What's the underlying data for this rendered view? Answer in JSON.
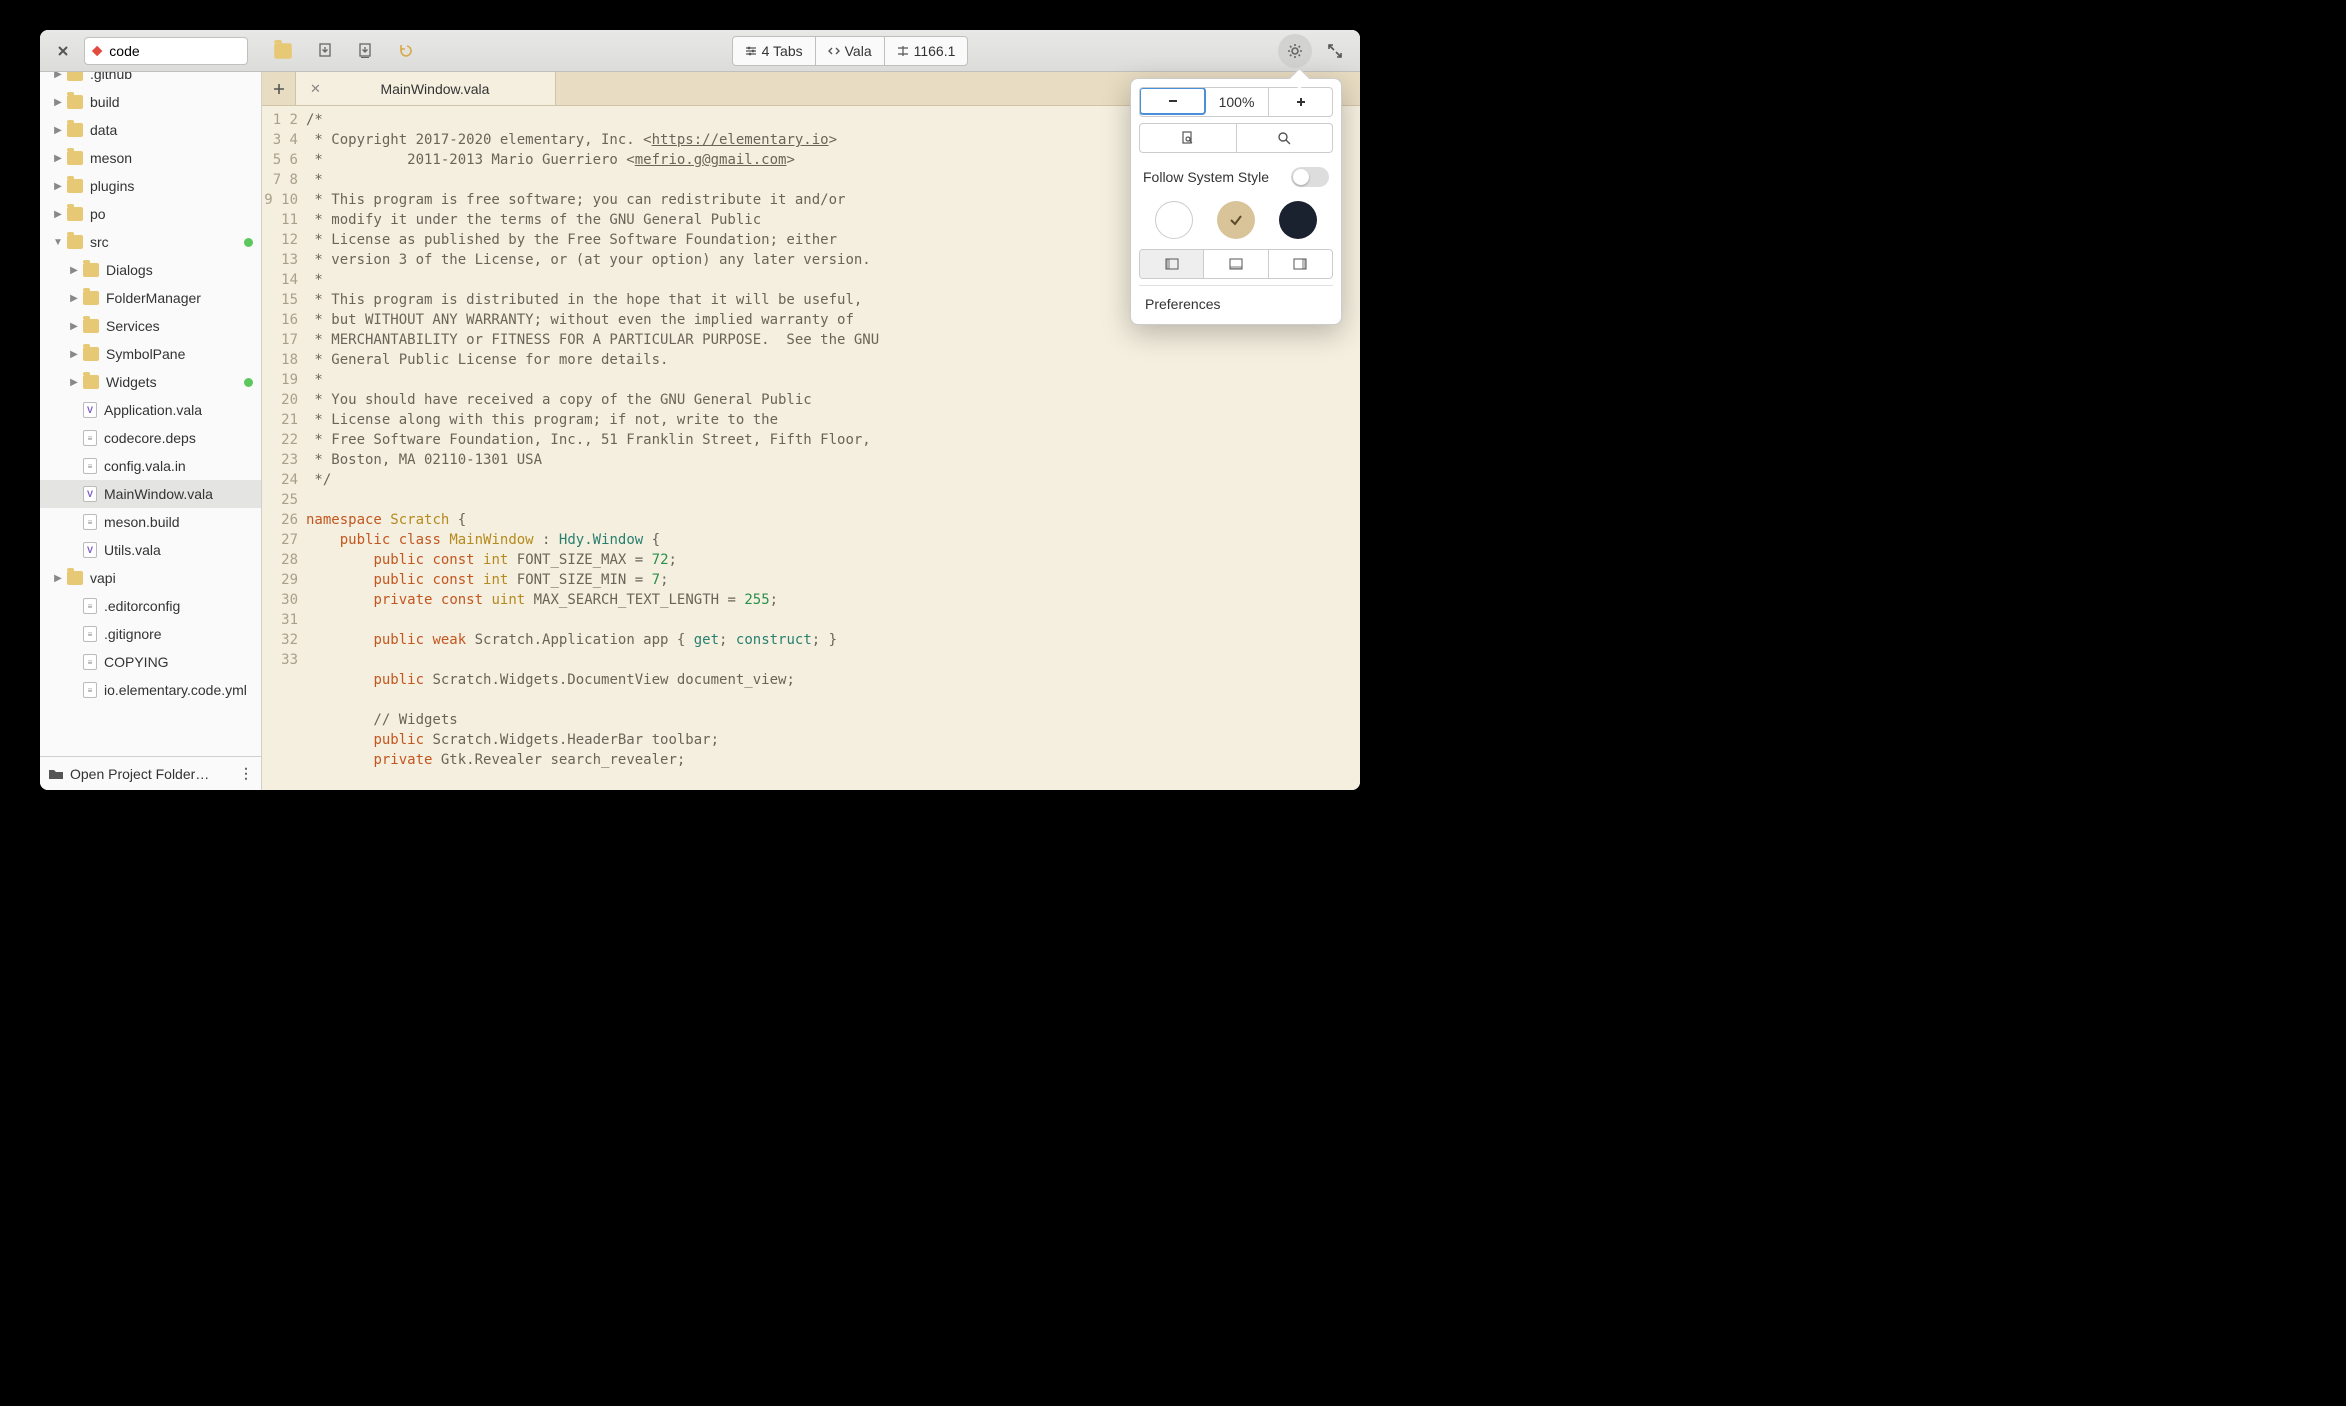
{
  "search": {
    "value": "code"
  },
  "toolbar": {
    "tabs_label": "4 Tabs",
    "lang_label": "Vala",
    "line_label": "1166.1"
  },
  "tree": [
    {
      "d": 0,
      "t": "folder",
      "exp": "right",
      "label": ".github",
      "cut": true
    },
    {
      "d": 0,
      "t": "folder",
      "exp": "right",
      "label": "build"
    },
    {
      "d": 0,
      "t": "folder",
      "exp": "right",
      "label": "data"
    },
    {
      "d": 0,
      "t": "folder",
      "exp": "right",
      "label": "meson"
    },
    {
      "d": 0,
      "t": "folder",
      "exp": "right",
      "label": "plugins"
    },
    {
      "d": 0,
      "t": "folder",
      "exp": "right",
      "label": "po"
    },
    {
      "d": 0,
      "t": "folder",
      "exp": "down",
      "label": "src",
      "dot": true
    },
    {
      "d": 1,
      "t": "folder",
      "exp": "right",
      "label": "Dialogs"
    },
    {
      "d": 1,
      "t": "folder",
      "exp": "right",
      "label": "FolderManager"
    },
    {
      "d": 1,
      "t": "folder",
      "exp": "right",
      "label": "Services"
    },
    {
      "d": 1,
      "t": "folder",
      "exp": "right",
      "label": "SymbolPane"
    },
    {
      "d": 1,
      "t": "folder",
      "exp": "right",
      "label": "Widgets",
      "dot": true
    },
    {
      "d": 1,
      "t": "vala",
      "label": "Application.vala"
    },
    {
      "d": 1,
      "t": "file",
      "label": "codecore.deps"
    },
    {
      "d": 1,
      "t": "file",
      "label": "config.vala.in"
    },
    {
      "d": 1,
      "t": "vala",
      "label": "MainWindow.vala",
      "sel": true
    },
    {
      "d": 1,
      "t": "file",
      "label": "meson.build"
    },
    {
      "d": 1,
      "t": "vala",
      "label": "Utils.vala"
    },
    {
      "d": 0,
      "t": "folder",
      "exp": "right",
      "label": "vapi"
    },
    {
      "d": 0,
      "t": "file",
      "exp": "none",
      "label": ".editorconfig",
      "pad": true
    },
    {
      "d": 0,
      "t": "file",
      "exp": "none",
      "label": ".gitignore",
      "pad": true
    },
    {
      "d": 0,
      "t": "file",
      "exp": "none",
      "label": "COPYING",
      "pad": true
    },
    {
      "d": 0,
      "t": "file",
      "exp": "none",
      "label": "io.elementary.code.yml",
      "pad": true
    }
  ],
  "sidebar_foot": "Open Project Folder…",
  "tab": {
    "label": "MainWindow.vala"
  },
  "popover": {
    "zoom": "100%",
    "follow_label": "Follow System Style",
    "pref_label": "Preferences"
  },
  "code": {
    "start": 1,
    "lines": [
      {
        "raw": "/*"
      },
      {
        "html": " * Copyright 2017-2020 elementary, Inc. &lt;<a href='#'>https://elementary.io</a>&gt;"
      },
      {
        "html": " *          2011-2013 Mario Guerriero &lt;<a href='#'>mefrio.g@gmail.com</a>&gt;"
      },
      {
        "raw": " *"
      },
      {
        "raw": " * This program is free software; you can redistribute it and/or"
      },
      {
        "raw": " * modify it under the terms of the GNU General Public"
      },
      {
        "raw": " * License as published by the Free Software Foundation; either"
      },
      {
        "raw": " * version 3 of the License, or (at your option) any later version."
      },
      {
        "raw": " *"
      },
      {
        "raw": " * This program is distributed in the hope that it will be useful,"
      },
      {
        "raw": " * but WITHOUT ANY WARRANTY; without even the implied warranty of"
      },
      {
        "raw": " * MERCHANTABILITY or FITNESS FOR A PARTICULAR PURPOSE.  See the GNU"
      },
      {
        "raw": " * General Public License for more details."
      },
      {
        "raw": " *"
      },
      {
        "raw": " * You should have received a copy of the GNU General Public"
      },
      {
        "raw": " * License along with this program; if not, write to the"
      },
      {
        "raw": " * Free Software Foundation, Inc., 51 Franklin Street, Fifth Floor,"
      },
      {
        "raw": " * Boston, MA 02110-1301 USA"
      },
      {
        "raw": " */"
      },
      {
        "raw": ""
      },
      {
        "html": "<span class='kw'>namespace</span> <span class='typ'>Scratch</span> {"
      },
      {
        "html": "    <span class='kw'>public</span> <span class='kw'>class</span> <span class='typ'>MainWindow</span> : <span class='cls'>Hdy.Window</span> {"
      },
      {
        "html": "        <span class='kw'>public</span> <span class='kw'>const</span> <span class='typ'>int</span> FONT_SIZE_MAX = <span class='num'>72</span>;"
      },
      {
        "html": "        <span class='kw'>public</span> <span class='kw'>const</span> <span class='typ'>int</span> FONT_SIZE_MIN = <span class='num'>7</span>;"
      },
      {
        "html": "        <span class='kw'>private</span> <span class='kw'>const</span> <span class='typ'>uint</span> MAX_SEARCH_TEXT_LENGTH = <span class='num'>255</span>;"
      },
      {
        "raw": ""
      },
      {
        "html": "        <span class='kw'>public</span> <span class='kw'>weak</span> Scratch.Application app { <span class='meth'>get</span>; <span class='meth'>construct</span>; }"
      },
      {
        "raw": ""
      },
      {
        "html": "        <span class='kw'>public</span> Scratch.Widgets.DocumentView document_view;"
      },
      {
        "raw": ""
      },
      {
        "html": "        // Widgets"
      },
      {
        "html": "        <span class='kw'>public</span> Scratch.Widgets.HeaderBar toolbar;"
      },
      {
        "html": "        <span class='kw'>private</span> Gtk.Revealer search_revealer;"
      }
    ]
  }
}
